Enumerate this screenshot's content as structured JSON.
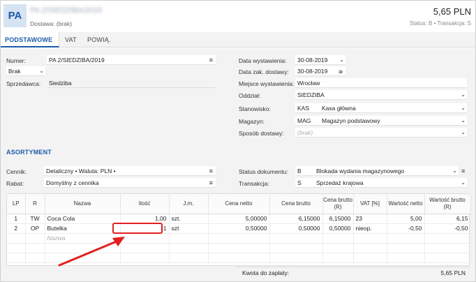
{
  "header": {
    "avatar": "PA",
    "title": "PA 2/SIEDZIBA/2019",
    "subtitle": "Dostawa: (brak)",
    "amount": "5,65 PLN",
    "status_line": "Status: B  •  Transakcja: S"
  },
  "tabs": [
    {
      "label": "PODSTAWOWE",
      "active": true
    },
    {
      "label": "VAT",
      "active": false
    },
    {
      "label": "POWIĄ.",
      "active": false
    }
  ],
  "left": {
    "numer_label": "Numer:",
    "numer_value": "PA 2/SIEDZIBA/2019",
    "brak_value": "Brak",
    "sprzedawca_label": "Sprzedawca:",
    "sprzedawca_value": "Siedziba"
  },
  "right": {
    "data_wyst_label": "Data wystawienia:",
    "data_wyst_value": "30-08-2019",
    "data_zak_label": "Data zak. dostawy:",
    "data_zak_value": "30-08-2019",
    "miejsce_label": "Miejsce wystawienia:",
    "miejsce_value": "Wrocław",
    "oddzial_label": "Oddział:",
    "oddzial_value": "SIEDZIBA",
    "stanowisko_label": "Stanowisko:",
    "stanowisko_code": "KAS",
    "stanowisko_name": "Kasa główna",
    "magazyn_label": "Magazyn:",
    "magazyn_code": "MAG",
    "magazyn_name": "Magazyn podstawowy",
    "sposob_label": "Sposób dostawy:",
    "sposob_placeholder": "(brak)"
  },
  "asortyment": {
    "title": "ASORTYMENT",
    "cennik_label": "Cennik:",
    "cennik_value": "Detaliczny • Waluta: PLN •",
    "rabat_label": "Rabat:",
    "rabat_value": "Domyślny z cennika",
    "status_label": "Status dokumentu:",
    "status_code": "B",
    "status_name": "Blokada wydania magazynowego",
    "transakcja_label": "Transakcja:",
    "transakcja_code": "S",
    "transakcja_name": "Sprzedaż krajowa"
  },
  "grid": {
    "columns": [
      "LP",
      "R",
      "Nazwa",
      "Ilość",
      "J.m.",
      "Cena netto",
      "Cena brutto",
      "Cena brutto (R)",
      "VAT [%]",
      "Wartość netto",
      "Wartość brutto (R)"
    ],
    "rows": [
      [
        "1",
        "TW",
        "Coca Cola",
        "1,00",
        "szt.",
        "5,00000",
        "6,15000",
        "6,15000",
        "23",
        "5,00",
        "6,15"
      ],
      [
        "2",
        "OP",
        "Butelka",
        "-1",
        "szt",
        "0,50000",
        "0,50000",
        "0,50000",
        "nieop.",
        "-0,50",
        "-0,50"
      ]
    ],
    "new_row_placeholder": "Nazwa"
  },
  "footer": {
    "total_label": "Kwota do zapłaty:",
    "total_value": "5,65 PLN"
  },
  "colors": {
    "accent": "#1a5aa8",
    "highlight": "#e02020"
  }
}
